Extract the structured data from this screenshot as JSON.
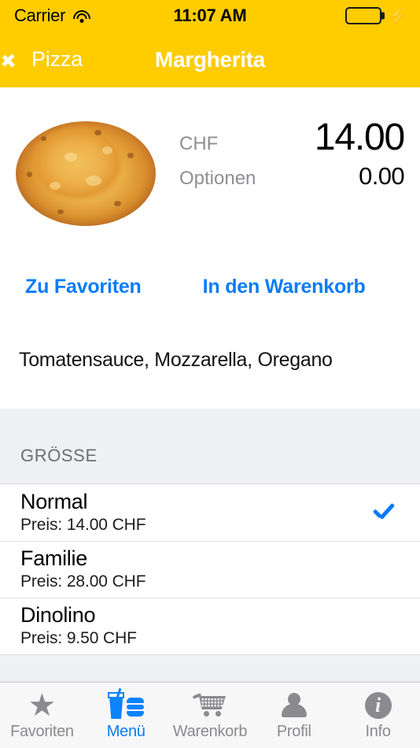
{
  "statusbar": {
    "carrier": "Carrier",
    "time": "11:07 AM",
    "wifi_icon": "wifi-icon",
    "battery_icon": "battery-full-icon",
    "charging_icon": "lightning-bolt-icon"
  },
  "navbar": {
    "back_label": "Pizza",
    "back_icon": "chevron-left-icon",
    "title": "Margherita",
    "background": "#FFCC00"
  },
  "product": {
    "image_alt": "margherita-pizza-photo",
    "currency_label": "CHF",
    "price": "14.00",
    "options_label": "Optionen",
    "options_price": "0.00",
    "description": "Tomatensauce, Mozzarella, Oregano"
  },
  "actions": {
    "favorite_label": "Zu Favoriten",
    "cart_label": "In den Warenkorb",
    "accent": "#0A7CF5"
  },
  "size_section": {
    "header": "GRÖSSE",
    "options": [
      {
        "name": "Normal",
        "price_line": "Preis: 14.00 CHF",
        "selected": true
      },
      {
        "name": "Familie",
        "price_line": "Preis: 28.00 CHF",
        "selected": false
      },
      {
        "name": "Dinolino",
        "price_line": "Preis: 9.50 CHF",
        "selected": false
      }
    ],
    "check_icon": "checkmark-icon",
    "check_color": "#007AFF"
  },
  "tabbar": {
    "active_color": "#0A7CF5",
    "inactive_color": "#8A8A8F",
    "tabs": [
      {
        "label": "Favoriten",
        "icon": "star-icon",
        "active": false
      },
      {
        "label": "Menü",
        "icon": "food-drink-icon",
        "active": true
      },
      {
        "label": "Warenkorb",
        "icon": "shopping-cart-icon",
        "active": false
      },
      {
        "label": "Profil",
        "icon": "person-icon",
        "active": false
      },
      {
        "label": "Info",
        "icon": "info-circle-icon",
        "active": false
      }
    ]
  }
}
